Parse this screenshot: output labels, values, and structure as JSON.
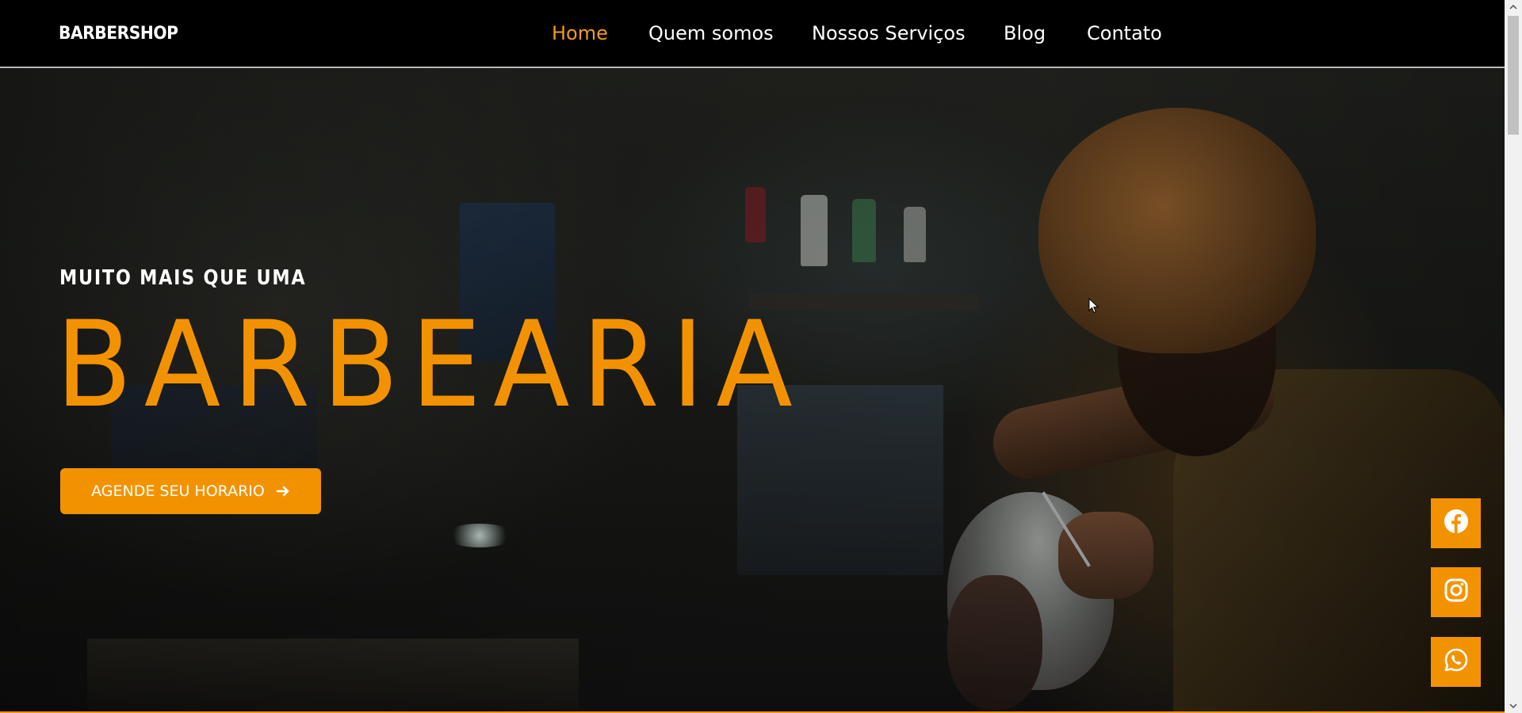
{
  "header": {
    "logo": "BARBERSHOP",
    "nav": [
      {
        "label": "Home",
        "active": true
      },
      {
        "label": "Quem somos",
        "active": false
      },
      {
        "label": "Nossos Serviços",
        "active": false
      },
      {
        "label": "Blog",
        "active": false
      },
      {
        "label": "Contato",
        "active": false
      }
    ]
  },
  "hero": {
    "kicker": "MUITO MAIS QUE UMA",
    "headline": "BARBEARIA",
    "cta_label": "AGENDE SEU HORARIO",
    "cta_icon": "arrow-right-icon"
  },
  "social": [
    {
      "icon": "facebook-icon"
    },
    {
      "icon": "instagram-icon"
    },
    {
      "icon": "whatsapp-icon"
    }
  ],
  "colors": {
    "accent": "#f39200",
    "nav_text": "#ffffff",
    "nav_active": "#f39c12",
    "background": "#000000"
  }
}
